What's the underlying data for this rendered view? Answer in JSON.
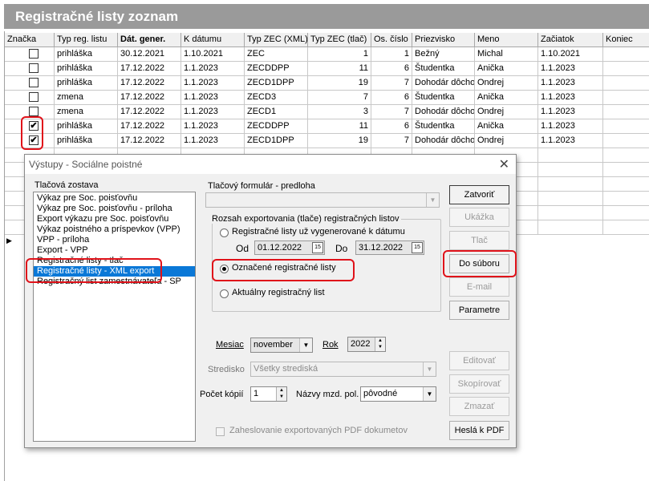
{
  "list_title": "Registračné listy zoznam",
  "grid": {
    "columns": [
      "Značka",
      "Typ reg. listu",
      "Dát. gener.",
      "K dátumu",
      "Typ ZEC (XML)",
      "Typ ZEC (tlač)",
      "Os. číslo",
      "Priezvisko",
      "Meno",
      "Začiatok",
      "Koniec"
    ],
    "rows": [
      {
        "checked": false,
        "c": [
          "",
          "prihláška",
          "30.12.2021",
          "1.10.2021",
          "ZEC",
          "1",
          "1",
          "Bežný",
          "Michal",
          "1.10.2021",
          ""
        ]
      },
      {
        "checked": false,
        "c": [
          "",
          "prihláška",
          "17.12.2022",
          "1.1.2023",
          "ZECDDPP",
          "11",
          "6",
          "Študentka",
          "Anička",
          "1.1.2023",
          ""
        ]
      },
      {
        "checked": false,
        "c": [
          "",
          "prihláška",
          "17.12.2022",
          "1.1.2023",
          "ZECD1DPP",
          "19",
          "7",
          "Dohodár dôchod",
          "Ondrej",
          "1.1.2023",
          ""
        ]
      },
      {
        "checked": false,
        "c": [
          "",
          "zmena",
          "17.12.2022",
          "1.1.2023",
          "ZECD3",
          "7",
          "6",
          "Študentka",
          "Anička",
          "1.1.2023",
          ""
        ]
      },
      {
        "checked": false,
        "c": [
          "",
          "zmena",
          "17.12.2022",
          "1.1.2023",
          "ZECD1",
          "3",
          "7",
          "Dohodár dôchod",
          "Ondrej",
          "1.1.2023",
          ""
        ]
      },
      {
        "checked": true,
        "c": [
          "",
          "prihláška",
          "17.12.2022",
          "1.1.2023",
          "ZECDDPP",
          "11",
          "6",
          "Študentka",
          "Anička",
          "1.1.2023",
          ""
        ]
      },
      {
        "checked": true,
        "c": [
          "",
          "prihláška",
          "17.12.2022",
          "1.1.2023",
          "ZECD1DPP",
          "19",
          "7",
          "Dohodár dôchod",
          "Ondrej",
          "1.1.2023",
          ""
        ]
      }
    ],
    "check_mark": "✔",
    "row_indicator": "▶"
  },
  "dialog": {
    "title": "Výstupy - Sociálne poistné",
    "close_icon": "✕",
    "report_label": "Tlačová zostava",
    "reports": [
      "Výkaz pre Soc. poisťovňu",
      "Výkaz pre Soc. poisťovňu - príloha",
      "Export výkazu pre Soc. poisťovňu",
      "Výkaz poistného a príspevkov (VPP)",
      "VPP - príloha",
      "Export - VPP",
      "Registračné listy - tlač",
      "Registračné listy - XML export",
      "Registračný list zamestnávateľa - SP"
    ],
    "selected_report": 7,
    "template_label": "Tlačový formulár - predloha",
    "template_value": "",
    "range_label": "Rozsah exportovania (tlače) registračných listov",
    "radio_generated": "Registračné listy už vygenerované k dátumu",
    "from_label": "Od",
    "from_date": "01.12.2022",
    "to_label": "Do",
    "to_date": "31.12.2022",
    "radio_marked": "Označené registračné listy",
    "radio_current": "Aktuálny registračný list",
    "month_label": "Mesiac",
    "month_value": "november",
    "year_label": "Rok",
    "year_value": "2022",
    "center_label": "Stredisko",
    "center_value": "Všetky strediská",
    "copies_label": "Počet kópií",
    "copies_value": "1",
    "payroll_label": "Názvy mzd. pol.",
    "payroll_value": "pôvodné",
    "encrypt_label": "Zaheslovanie exportovaných PDF dokumetov",
    "buttons": {
      "close": "Zatvoriť",
      "preview": "Ukážka",
      "print": "Tlač",
      "to_file": "Do súboru",
      "email": "E-mail",
      "params": "Parametre",
      "edit": "Editovať",
      "copy": "Skopírovať",
      "delete": "Zmazať",
      "pdf_password": "Heslá k PDF"
    },
    "selected_radio": "marked"
  },
  "colors": {
    "highlight": "#e0121a",
    "selection": "#0a78d7",
    "title_bar": "#9a9a9a"
  }
}
